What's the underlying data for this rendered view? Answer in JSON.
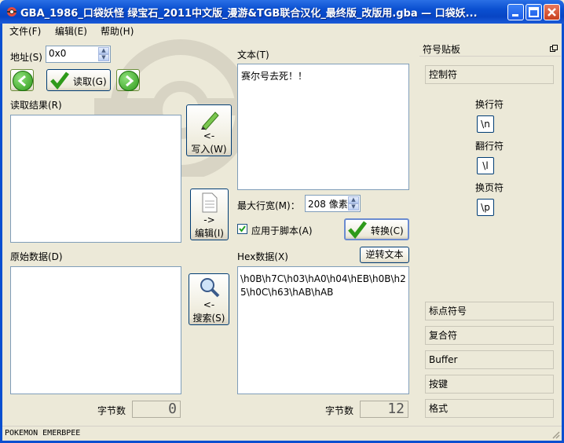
{
  "window": {
    "title": "GBA_1986_口袋妖怪 绿宝石_2011中文版_漫游&TGB联合汉化_最终版_改版用.gba — 口袋妖..."
  },
  "menu": [
    "文件(F)",
    "编辑(E)",
    "帮助(H)"
  ],
  "address": {
    "label": "地址(S)",
    "value": "0x0"
  },
  "read_button": "读取(G)",
  "read_result_label": "读取结果(R)",
  "write_button": {
    "line1": "<-",
    "line2": "写入(W)"
  },
  "edit_button": {
    "line1": "->",
    "line2": "编辑(I)"
  },
  "search_button": {
    "line1": "<-",
    "line2": "搜索(S)"
  },
  "raw_data_label": "原始数据(D)",
  "text": {
    "label": "文本(T)",
    "content": "赛尔号去死！！"
  },
  "max_line_width": {
    "label": "最大行宽(M)：",
    "value": "208 像素"
  },
  "apply_script": {
    "label": "应用于脚本(A)",
    "checked": true
  },
  "convert_button": "转换(C)",
  "hex": {
    "label": "Hex数据(X)",
    "content": "\\h0B\\h7C\\h03\\hA0\\h04\\hEB\\h0B\\h25\\h0C\\h63\\hAB\\hAB",
    "reverse_button": "逆转文本"
  },
  "left_byte_count": {
    "label": "字节数",
    "value": "0"
  },
  "right_byte_count": {
    "label": "字节数",
    "value": "12"
  },
  "clipboard": {
    "title": "符号贴板",
    "control_button": "控制符",
    "newline_label": "换行符",
    "newline_symbol": "\\n",
    "scroll_label": "翻行符",
    "scroll_symbol": "\\l",
    "pagebreak_label": "换页符",
    "pagebreak_symbol": "\\p",
    "bottom_buttons": [
      "标点符号",
      "复合符",
      "Buffer",
      "按键",
      "格式"
    ]
  },
  "status": "POKEMON EMERBPEE"
}
